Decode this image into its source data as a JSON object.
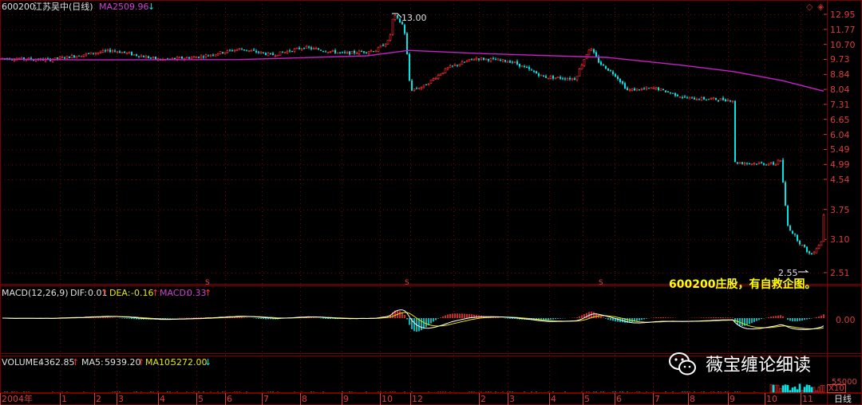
{
  "header": {
    "code": "600200",
    "name": "江苏吴中",
    "period": "(日线)",
    "ma250_label": "MA250:",
    "ma250_value": "9.96",
    "ma250_arrow": "↓"
  },
  "annotations": {
    "high_label": "13.00",
    "low_label": "2.55",
    "title_note": "600200庄股，有自救企图。",
    "watermark": "薇宝缠论细读",
    "wechat_icon": "wechat-icon",
    "ex_right_marker": "S",
    "corner_icons": [
      "diamond-icon",
      "restore-icon"
    ]
  },
  "price_axis": {
    "ticks": [
      "12.95",
      "11.77",
      "10.70",
      "9.73",
      "8.84",
      "8.04",
      "7.31",
      "6.65",
      "6.04",
      "5.49",
      "4.99",
      "4.54",
      "3.75",
      "3.10",
      "2.51"
    ],
    "scale": "log"
  },
  "macd_panel": {
    "label": "MACD(12,26,9)",
    "dif_label": "DIF:",
    "dif_value": "0.01",
    "dif_arrow": "↑",
    "dea_label": "DEA:",
    "dea_value": "-0.16",
    "dea_arrow": "↑",
    "macd_label": "MACD:",
    "macd_value": "0.33",
    "macd_arrow": "↑",
    "axis_tick": "0.00"
  },
  "volume_panel": {
    "label": "VOLUME:",
    "value": "4362.85",
    "arrow": "↑",
    "ma5_label": "MA5:",
    "ma5_value": "5939.20",
    "ma5_arrow": "↑",
    "ma10_label": "MA10:",
    "ma10_value": "5272.00",
    "ma10_arrow": "↓",
    "axis_tick": "55000",
    "axis_unit": "X10"
  },
  "time_axis": {
    "labels": [
      "2004年",
      "1",
      "2",
      "3",
      "4",
      "5",
      "6",
      "7",
      "8",
      "9",
      "10",
      "12",
      "2",
      "3",
      "4",
      "5",
      "6",
      "7",
      "8",
      "9",
      "10",
      "11"
    ],
    "period_tab": "日线"
  },
  "colors": {
    "up": "#ff3232",
    "down": "#00e4e4",
    "ma250": "#c81ec8",
    "dif": "#ffffff",
    "dea": "#e8e800",
    "grid": "#7a0000",
    "axis_text": "#dc3c3c",
    "note": "#ffff00"
  },
  "chart_data": {
    "type": "candlestick",
    "scale": "log",
    "ylim": [
      2.51,
      12.95
    ],
    "high": 13.0,
    "low": 2.55,
    "price_path": [
      [
        0,
        9.8
      ],
      [
        60,
        9.7
      ],
      [
        140,
        10.3
      ],
      [
        200,
        9.7
      ],
      [
        250,
        9.9
      ],
      [
        300,
        10.4
      ],
      [
        340,
        10.0
      ],
      [
        380,
        10.5
      ],
      [
        430,
        10.1
      ],
      [
        470,
        10.3
      ],
      [
        487,
        11.0
      ],
      [
        492,
        12.9
      ],
      [
        505,
        12.0
      ],
      [
        513,
        8.0
      ],
      [
        530,
        8.2
      ],
      [
        560,
        9.2
      ],
      [
        595,
        9.8
      ],
      [
        640,
        9.6
      ],
      [
        680,
        8.7
      ],
      [
        720,
        8.6
      ],
      [
        738,
        10.5
      ],
      [
        750,
        9.5
      ],
      [
        770,
        8.8
      ],
      [
        785,
        8.0
      ],
      [
        820,
        8.1
      ],
      [
        860,
        7.6
      ],
      [
        900,
        7.55
      ],
      [
        918,
        7.5
      ],
      [
        920,
        5.05
      ],
      [
        972,
        5.0
      ],
      [
        976,
        5.3
      ],
      [
        985,
        3.4
      ],
      [
        1000,
        3.05
      ],
      [
        1015,
        2.8
      ],
      [
        1030,
        3.1
      ],
      [
        1033,
        4.7
      ]
    ],
    "ma250_path": [
      [
        0,
        9.75
      ],
      [
        100,
        9.7
      ],
      [
        300,
        9.72
      ],
      [
        460,
        9.95
      ],
      [
        512,
        10.3
      ],
      [
        600,
        10.1
      ],
      [
        760,
        9.85
      ],
      [
        850,
        9.4
      ],
      [
        920,
        9.0
      ],
      [
        980,
        8.5
      ],
      [
        1032,
        7.95
      ]
    ]
  }
}
